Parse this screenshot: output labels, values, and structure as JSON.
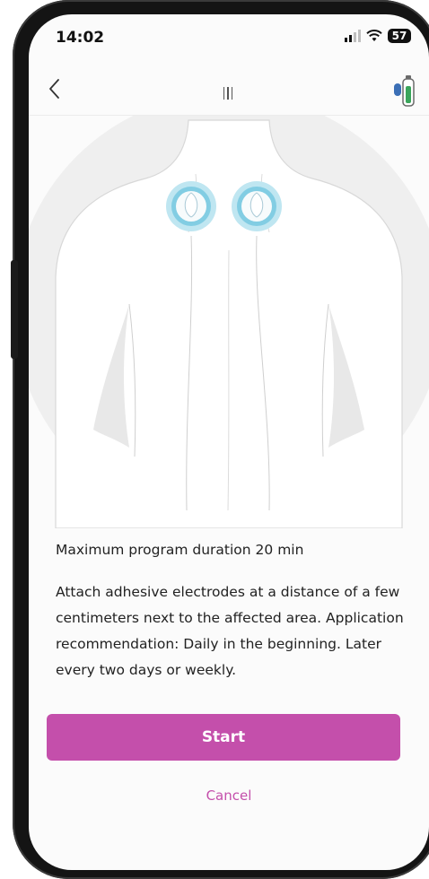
{
  "status_bar": {
    "time": "14:02",
    "battery": "57"
  },
  "nav": {
    "back_icon": "chevron-left-icon",
    "menu_icon": "menu-handle-icon",
    "device_icon": "device-battery-icon"
  },
  "program": {
    "duration_text": "Maximum program duration 20 min",
    "description": "Attach adhesive electrodes at a distance of a few centimeters next to the affected area. Application recommendation: Daily in the beginning. Later every two days or weekly."
  },
  "actions": {
    "start_label": "Start",
    "cancel_label": "Cancel"
  },
  "colors": {
    "accent": "#c44fab",
    "electrode_ring": "#8fd3e6",
    "background": "#fbfbfb"
  }
}
